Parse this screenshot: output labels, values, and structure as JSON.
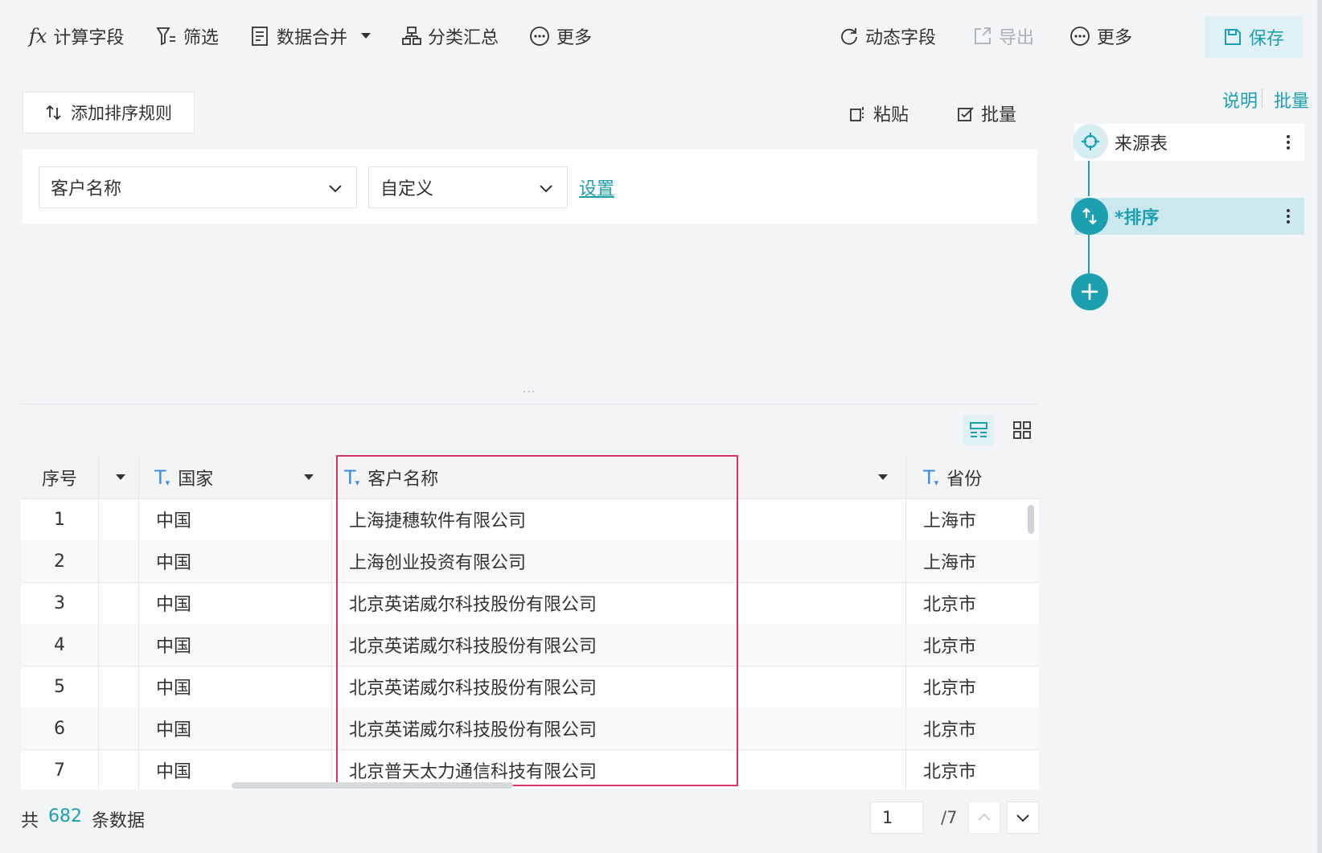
{
  "toolbar": {
    "calc_field": "计算字段",
    "filter": "筛选",
    "merge": "数据合并",
    "group_summary": "分类汇总",
    "more_left": "更多",
    "dynamic_field": "动态字段",
    "export": "导出",
    "more_right": "更多",
    "save": "保存",
    "fx_glyph": "fx"
  },
  "sort_panel": {
    "add_rule": "添加排序规则",
    "paste": "粘贴",
    "batch": "批量",
    "field_select": "客户名称",
    "order_select": "自定义",
    "settings_link": "设置",
    "splitter_glyph": "..."
  },
  "table": {
    "columns": [
      {
        "label": "序号"
      },
      {
        "label": "国家",
        "type_glyph": "T"
      },
      {
        "label": "客户名称",
        "type_glyph": "T"
      },
      {
        "label": "省份",
        "type_glyph": "T"
      }
    ],
    "rows": [
      {
        "idx": "1",
        "country": "中国",
        "customer": "上海捷穗软件有限公司",
        "province": "上海市"
      },
      {
        "idx": "2",
        "country": "中国",
        "customer": "上海创业投资有限公司",
        "province": "上海市"
      },
      {
        "idx": "3",
        "country": "中国",
        "customer": "北京英诺威尔科技股份有限公司",
        "province": "北京市"
      },
      {
        "idx": "4",
        "country": "中国",
        "customer": "北京英诺威尔科技股份有限公司",
        "province": "北京市"
      },
      {
        "idx": "5",
        "country": "中国",
        "customer": "北京英诺威尔科技股份有限公司",
        "province": "北京市"
      },
      {
        "idx": "6",
        "country": "中国",
        "customer": "北京英诺威尔科技股份有限公司",
        "province": "北京市"
      },
      {
        "idx": "7",
        "country": "中国",
        "customer": "北京普天太力通信科技有限公司",
        "province": "北京市"
      }
    ]
  },
  "footer": {
    "total_prefix": "共",
    "total_count": "682",
    "total_suffix": "条数据",
    "page_current": "1",
    "page_total": "/7"
  },
  "side": {
    "help": "说明",
    "batch": "批量",
    "steps": [
      {
        "label": "来源表",
        "icon": "target-icon"
      },
      {
        "label": "*排序",
        "icon": "sort-icon"
      }
    ],
    "add_glyph": "+"
  },
  "colors": {
    "accent": "#1c9fb0",
    "highlight_border": "#d7336b",
    "type_icon": "#3a8ee6"
  }
}
